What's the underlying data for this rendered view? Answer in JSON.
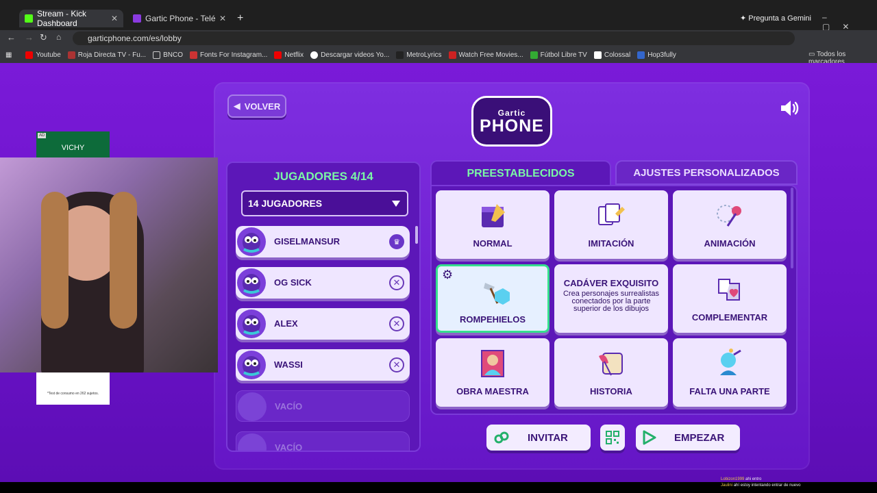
{
  "browser": {
    "tabs": [
      {
        "title": "Stream - Kick Dashboard",
        "color": "#53fc18",
        "active": true
      },
      {
        "title": "Gartic Phone - Teléfono Descon",
        "color": "#8a3ae0",
        "active": false
      }
    ],
    "url": "garticphone.com/es/lobby",
    "gemini": "Pregunta a Gemini",
    "bookmarks": [
      "Youtube",
      "Roja Directa TV - Fu...",
      "BNCO",
      "Fonts For Instagram...",
      "Netflix",
      "Descargar videos Yo...",
      "MetroLyrics",
      "Watch Free Movies...",
      "Fútbol Libre TV",
      "Colossal",
      "Hop3fully"
    ],
    "all_bookmarks": "Todos los marcadores"
  },
  "game": {
    "back_label": "VOLVER",
    "logo_top": "Gartic",
    "logo_bottom": "PHONE",
    "players_title": "JUGADORES 4/14",
    "player_select": "14 JUGADORES",
    "players": [
      {
        "name": "GISELMANSUR",
        "action": "crown"
      },
      {
        "name": "OG SICK",
        "action": "remove"
      },
      {
        "name": "ALEX",
        "action": "remove"
      },
      {
        "name": "WASSI",
        "action": "remove"
      },
      {
        "name": "VACÍO",
        "action": "none"
      },
      {
        "name": "VACÍO",
        "action": "none"
      }
    ],
    "tab_presets": "PREESTABLECIDOS",
    "tab_custom": "AJUSTES PERSONALIZADOS",
    "modes": [
      {
        "label": "NORMAL",
        "icon": "calendar-pencil-icon"
      },
      {
        "label": "IMITACIÓN",
        "icon": "cards-pencil-icon"
      },
      {
        "label": "ANIMACIÓN",
        "icon": "pin-animation-icon"
      },
      {
        "label": "ROMPEHIELOS",
        "icon": "hammer-ice-icon",
        "selected": true
      },
      {
        "label": "CADÁVER EXQUISITO",
        "icon": "",
        "description": "Crea personajes surrealistas conectados por la parte superior de los dibujos"
      },
      {
        "label": "COMPLEMENTAR",
        "icon": "puzzle-heart-icon"
      },
      {
        "label": "OBRA MAESTRA",
        "icon": "portrait-icon"
      },
      {
        "label": "HISTORIA",
        "icon": "scroll-quill-icon"
      },
      {
        "label": "FALTA UNA PARTE",
        "icon": "head-brush-icon"
      }
    ],
    "invite_label": "INVITAR",
    "start_label": "EMPEZAR"
  },
  "overlay": {
    "ad_tag": "AD",
    "ad_brand": "VICHY",
    "ad_note": "*Test de consumo en 262 sujetos.",
    "chat": [
      {
        "user": "Lobizon1999",
        "text": "ahi entro"
      },
      {
        "user": "Jaulini",
        "text": "ahí estoy intentando entrar de nuevo"
      }
    ]
  },
  "colors": {
    "accent_green": "#7bf7a6",
    "purple": "#6a12c8"
  }
}
